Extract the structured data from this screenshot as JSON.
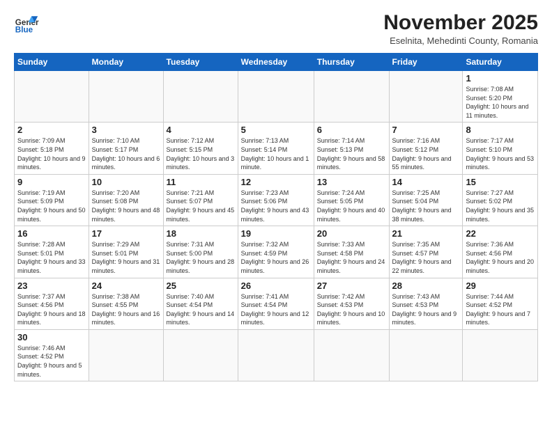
{
  "logo": {
    "text_general": "General",
    "text_blue": "Blue"
  },
  "header": {
    "month": "November 2025",
    "location": "Eselnita, Mehedinti County, Romania"
  },
  "weekdays": [
    "Sunday",
    "Monday",
    "Tuesday",
    "Wednesday",
    "Thursday",
    "Friday",
    "Saturday"
  ],
  "weeks": [
    [
      {
        "day": "",
        "info": ""
      },
      {
        "day": "",
        "info": ""
      },
      {
        "day": "",
        "info": ""
      },
      {
        "day": "",
        "info": ""
      },
      {
        "day": "",
        "info": ""
      },
      {
        "day": "",
        "info": ""
      },
      {
        "day": "1",
        "info": "Sunrise: 7:08 AM\nSunset: 5:20 PM\nDaylight: 10 hours\nand 11 minutes."
      }
    ],
    [
      {
        "day": "2",
        "info": "Sunrise: 7:09 AM\nSunset: 5:18 PM\nDaylight: 10 hours\nand 9 minutes."
      },
      {
        "day": "3",
        "info": "Sunrise: 7:10 AM\nSunset: 5:17 PM\nDaylight: 10 hours\nand 6 minutes."
      },
      {
        "day": "4",
        "info": "Sunrise: 7:12 AM\nSunset: 5:15 PM\nDaylight: 10 hours\nand 3 minutes."
      },
      {
        "day": "5",
        "info": "Sunrise: 7:13 AM\nSunset: 5:14 PM\nDaylight: 10 hours\nand 1 minute."
      },
      {
        "day": "6",
        "info": "Sunrise: 7:14 AM\nSunset: 5:13 PM\nDaylight: 9 hours\nand 58 minutes."
      },
      {
        "day": "7",
        "info": "Sunrise: 7:16 AM\nSunset: 5:12 PM\nDaylight: 9 hours\nand 55 minutes."
      },
      {
        "day": "8",
        "info": "Sunrise: 7:17 AM\nSunset: 5:10 PM\nDaylight: 9 hours\nand 53 minutes."
      }
    ],
    [
      {
        "day": "9",
        "info": "Sunrise: 7:19 AM\nSunset: 5:09 PM\nDaylight: 9 hours\nand 50 minutes."
      },
      {
        "day": "10",
        "info": "Sunrise: 7:20 AM\nSunset: 5:08 PM\nDaylight: 9 hours\nand 48 minutes."
      },
      {
        "day": "11",
        "info": "Sunrise: 7:21 AM\nSunset: 5:07 PM\nDaylight: 9 hours\nand 45 minutes."
      },
      {
        "day": "12",
        "info": "Sunrise: 7:23 AM\nSunset: 5:06 PM\nDaylight: 9 hours\nand 43 minutes."
      },
      {
        "day": "13",
        "info": "Sunrise: 7:24 AM\nSunset: 5:05 PM\nDaylight: 9 hours\nand 40 minutes."
      },
      {
        "day": "14",
        "info": "Sunrise: 7:25 AM\nSunset: 5:04 PM\nDaylight: 9 hours\nand 38 minutes."
      },
      {
        "day": "15",
        "info": "Sunrise: 7:27 AM\nSunset: 5:02 PM\nDaylight: 9 hours\nand 35 minutes."
      }
    ],
    [
      {
        "day": "16",
        "info": "Sunrise: 7:28 AM\nSunset: 5:01 PM\nDaylight: 9 hours\nand 33 minutes."
      },
      {
        "day": "17",
        "info": "Sunrise: 7:29 AM\nSunset: 5:01 PM\nDaylight: 9 hours\nand 31 minutes."
      },
      {
        "day": "18",
        "info": "Sunrise: 7:31 AM\nSunset: 5:00 PM\nDaylight: 9 hours\nand 28 minutes."
      },
      {
        "day": "19",
        "info": "Sunrise: 7:32 AM\nSunset: 4:59 PM\nDaylight: 9 hours\nand 26 minutes."
      },
      {
        "day": "20",
        "info": "Sunrise: 7:33 AM\nSunset: 4:58 PM\nDaylight: 9 hours\nand 24 minutes."
      },
      {
        "day": "21",
        "info": "Sunrise: 7:35 AM\nSunset: 4:57 PM\nDaylight: 9 hours\nand 22 minutes."
      },
      {
        "day": "22",
        "info": "Sunrise: 7:36 AM\nSunset: 4:56 PM\nDaylight: 9 hours\nand 20 minutes."
      }
    ],
    [
      {
        "day": "23",
        "info": "Sunrise: 7:37 AM\nSunset: 4:56 PM\nDaylight: 9 hours\nand 18 minutes."
      },
      {
        "day": "24",
        "info": "Sunrise: 7:38 AM\nSunset: 4:55 PM\nDaylight: 9 hours\nand 16 minutes."
      },
      {
        "day": "25",
        "info": "Sunrise: 7:40 AM\nSunset: 4:54 PM\nDaylight: 9 hours\nand 14 minutes."
      },
      {
        "day": "26",
        "info": "Sunrise: 7:41 AM\nSunset: 4:54 PM\nDaylight: 9 hours\nand 12 minutes."
      },
      {
        "day": "27",
        "info": "Sunrise: 7:42 AM\nSunset: 4:53 PM\nDaylight: 9 hours\nand 10 minutes."
      },
      {
        "day": "28",
        "info": "Sunrise: 7:43 AM\nSunset: 4:53 PM\nDaylight: 9 hours\nand 9 minutes."
      },
      {
        "day": "29",
        "info": "Sunrise: 7:44 AM\nSunset: 4:52 PM\nDaylight: 9 hours\nand 7 minutes."
      }
    ],
    [
      {
        "day": "30",
        "info": "Sunrise: 7:46 AM\nSunset: 4:52 PM\nDaylight: 9 hours\nand 5 minutes."
      },
      {
        "day": "",
        "info": ""
      },
      {
        "day": "",
        "info": ""
      },
      {
        "day": "",
        "info": ""
      },
      {
        "day": "",
        "info": ""
      },
      {
        "day": "",
        "info": ""
      },
      {
        "day": "",
        "info": ""
      }
    ]
  ]
}
